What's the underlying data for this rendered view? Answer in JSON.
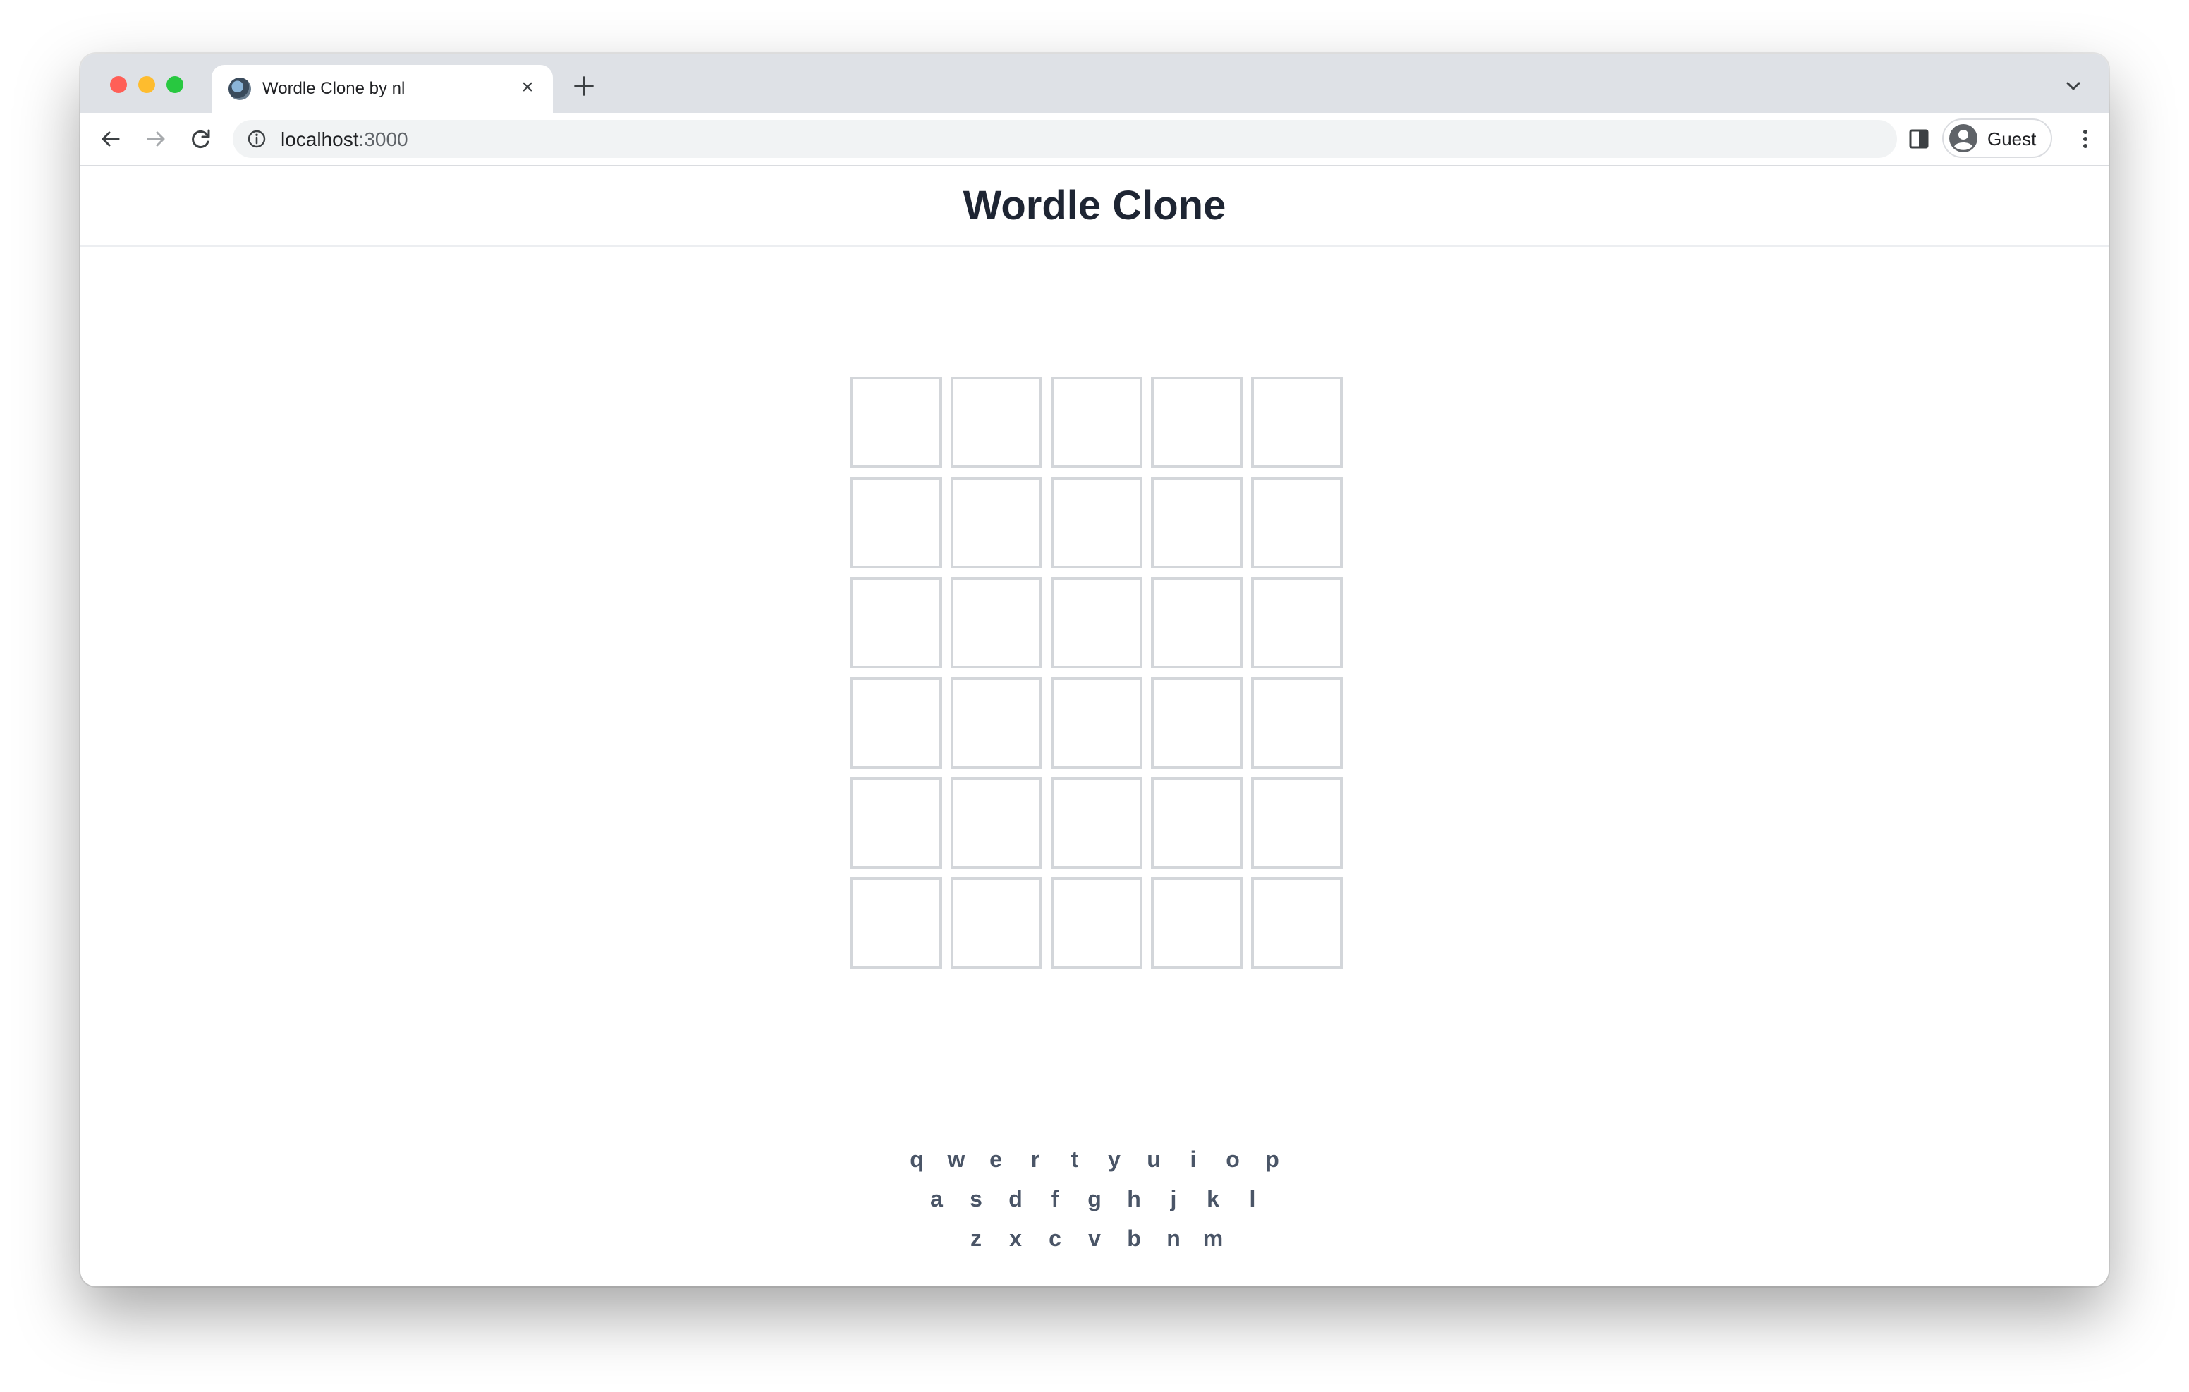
{
  "browser": {
    "tab_title": "Wordle Clone by nl",
    "url_host": "localhost",
    "url_port": ":3000",
    "profile_name": "Guest"
  },
  "page": {
    "title": "Wordle Clone"
  },
  "board": {
    "rows": 6,
    "cols": 5,
    "tiles": [
      [
        "",
        "",
        "",
        "",
        ""
      ],
      [
        "",
        "",
        "",
        "",
        ""
      ],
      [
        "",
        "",
        "",
        "",
        ""
      ],
      [
        "",
        "",
        "",
        "",
        ""
      ],
      [
        "",
        "",
        "",
        "",
        ""
      ],
      [
        "",
        "",
        "",
        "",
        ""
      ]
    ]
  },
  "keyboard": {
    "rows": [
      [
        "q",
        "w",
        "e",
        "r",
        "t",
        "y",
        "u",
        "i",
        "o",
        "p"
      ],
      [
        "a",
        "s",
        "d",
        "f",
        "g",
        "h",
        "j",
        "k",
        "l"
      ],
      [
        "z",
        "x",
        "c",
        "v",
        "b",
        "n",
        "m"
      ]
    ]
  },
  "colors": {
    "title": "#1e2533",
    "tile_border": "#d3d6da",
    "key_text": "#4a5567"
  },
  "icons": {
    "back": "arrow-left-icon",
    "forward": "arrow-right-icon",
    "reload": "reload-icon",
    "site_info": "info-icon",
    "side_panel": "side-panel-icon",
    "avatar": "account-circle-icon",
    "menu": "kebab-menu-icon",
    "new_tab": "plus-icon",
    "tab_close": "close-icon",
    "tab_list": "chevron-down-icon"
  }
}
